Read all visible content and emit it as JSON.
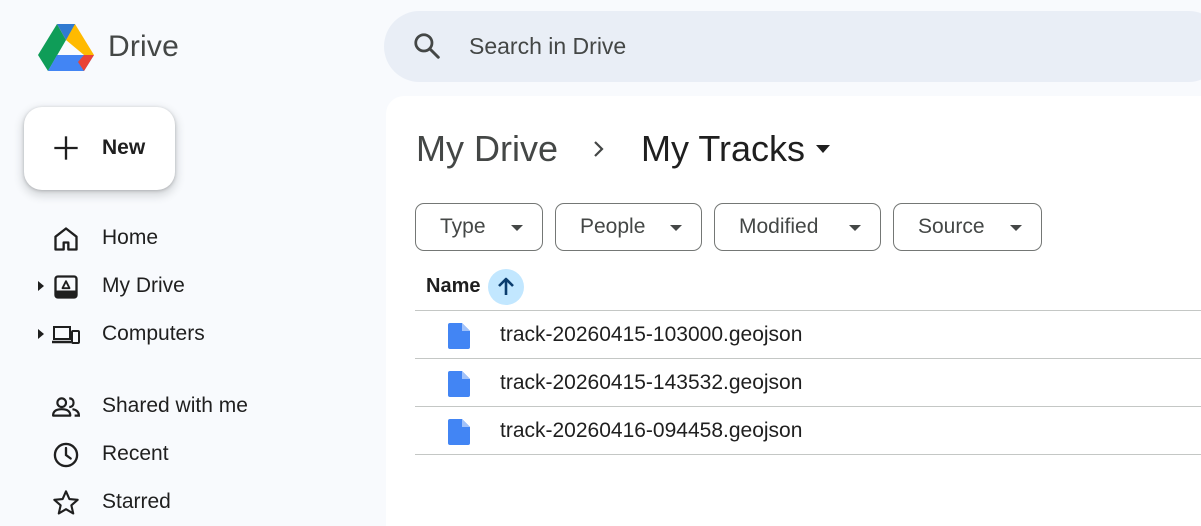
{
  "app": {
    "name": "Drive"
  },
  "search": {
    "placeholder": "Search in Drive"
  },
  "new_button": {
    "label": "New"
  },
  "sidebar": {
    "items": [
      {
        "label": "Home",
        "icon": "home-icon",
        "expandable": false
      },
      {
        "label": "My Drive",
        "icon": "my-drive-icon",
        "expandable": true
      },
      {
        "label": "Computers",
        "icon": "computers-icon",
        "expandable": true
      },
      {
        "label": "Shared with me",
        "icon": "people-icon",
        "expandable": false
      },
      {
        "label": "Recent",
        "icon": "clock-icon",
        "expandable": false
      },
      {
        "label": "Starred",
        "icon": "star-icon",
        "expandable": false
      }
    ]
  },
  "breadcrumb": {
    "parent": "My Drive",
    "current": "My Tracks"
  },
  "filters": [
    {
      "label": "Type"
    },
    {
      "label": "People"
    },
    {
      "label": "Modified"
    },
    {
      "label": "Source"
    }
  ],
  "table": {
    "name_header": "Name",
    "sort": "ascending",
    "files": [
      {
        "name": "track-20260415-103000.geojson",
        "icon": "document-icon"
      },
      {
        "name": "track-20260415-143532.geojson",
        "icon": "document-icon"
      },
      {
        "name": "track-20260416-094458.geojson",
        "icon": "document-icon"
      }
    ]
  },
  "colors": {
    "background": "#f8fafd",
    "search_bg": "#e9eef6",
    "sort_highlight": "#c2e7ff",
    "file_icon": "#4285f4",
    "sort_arrow": "#0b57d0"
  }
}
